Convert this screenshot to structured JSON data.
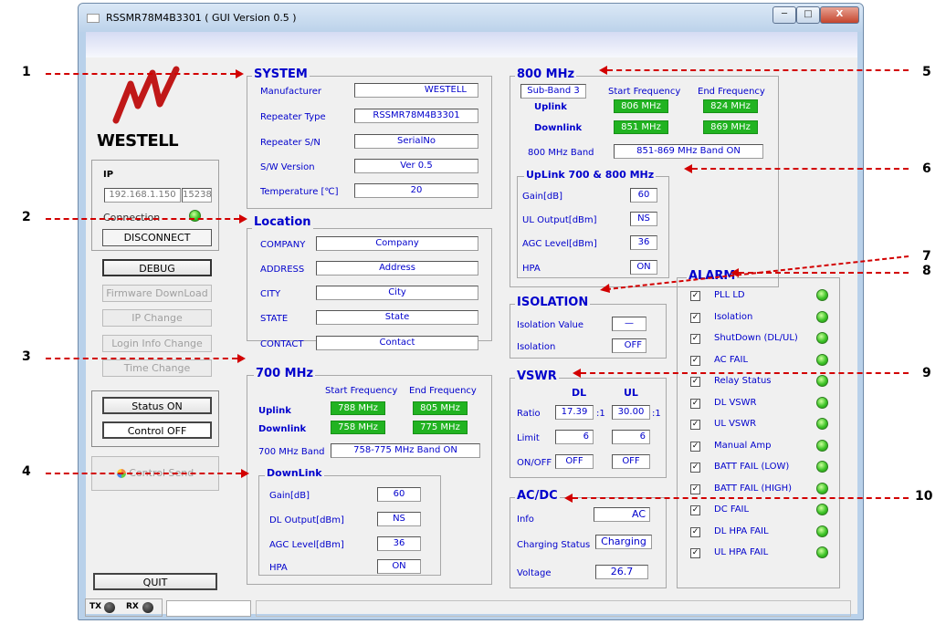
{
  "window": {
    "title": "RSSMR78M4B3301 ( GUI Version 0.5 )",
    "min": "─",
    "max": "□",
    "close": "X"
  },
  "logo": {
    "brand": "WESTELL"
  },
  "sidebar": {
    "ip_label": "IP",
    "ip_value": "192.168.1.150",
    "port_value": "15238",
    "connection_label": "Connection",
    "disconnect": "DISCONNECT",
    "debug": "DEBUG",
    "firmware": "Firmware DownLoad",
    "ip_change": "IP Change",
    "login_info": "Login Info Change",
    "time_change": "Time Change",
    "status_on": "Status ON",
    "control_off": "Control OFF",
    "control_send": "Control Send",
    "quit": "QUIT"
  },
  "statusbar": {
    "tx": "TX",
    "rx": "RX"
  },
  "system": {
    "title": "SYSTEM",
    "rows": [
      {
        "label": "Manufacturer",
        "value": "WESTELL"
      },
      {
        "label": "Repeater Type",
        "value": "RSSMR78M4B3301"
      },
      {
        "label": "Repeater S/N",
        "value": "SerialNo"
      },
      {
        "label": "S/W Version",
        "value": "Ver 0.5"
      },
      {
        "label": "Temperature [℃]",
        "value": "20"
      }
    ]
  },
  "location": {
    "title": "Location",
    "rows": [
      {
        "label": "COMPANY",
        "value": "Company"
      },
      {
        "label": "ADDRESS",
        "value": "Address"
      },
      {
        "label": "CITY",
        "value": "City"
      },
      {
        "label": "STATE",
        "value": "State"
      },
      {
        "label": "CONTACT",
        "value": "Contact"
      }
    ]
  },
  "mhz700": {
    "title": "700 MHz",
    "start_hdr": "Start Frequency",
    "end_hdr": "End Frequency",
    "uplink": "Uplink",
    "up_start": "788 MHz",
    "up_end": "805 MHz",
    "downlink": "Downlink",
    "down_start": "758 MHz",
    "down_end": "775 MHz",
    "band_label": "700 MHz Band",
    "band_value": "758-775 MHz Band ON"
  },
  "downlink": {
    "title": "DownLink",
    "rows": [
      {
        "label": "Gain[dB]",
        "value": "60"
      },
      {
        "label": "DL Output[dBm]",
        "value": "NS"
      },
      {
        "label": "AGC Level[dBm]",
        "value": "36"
      },
      {
        "label": "HPA",
        "value": "ON"
      }
    ]
  },
  "mhz800": {
    "title": "800 MHz",
    "subband": "Sub-Band 3",
    "start_hdr": "Start Frequency",
    "end_hdr": "End Frequency",
    "uplink": "Uplink",
    "up_start": "806 MHz",
    "up_end": "824 MHz",
    "downlink": "Downlink",
    "down_start": "851 MHz",
    "down_end": "869 MHz",
    "band_label": "800 MHz Band",
    "band_value": "851-869 MHz Band ON"
  },
  "uplink78": {
    "title": "UpLink 700 & 800 MHz",
    "rows": [
      {
        "label": "Gain[dB]",
        "value": "60"
      },
      {
        "label": "UL Output[dBm]",
        "value": "NS"
      },
      {
        "label": "AGC Level[dBm]",
        "value": "36"
      },
      {
        "label": "HPA",
        "value": "ON"
      }
    ]
  },
  "isolation": {
    "title": "ISOLATION",
    "value_label": "Isolation Value",
    "value": "—",
    "iso_label": "Isolation",
    "iso_value": "OFF"
  },
  "vswr": {
    "title": "VSWR",
    "dl": "DL",
    "ul": "UL",
    "ratio_label": "Ratio",
    "ratio_dl": "17.39",
    "ratio_ul": "30.00",
    "ratio_suffix": ":1",
    "limit_label": "Limit",
    "limit_dl": "6",
    "limit_ul": "6",
    "onoff_label": "ON/OFF",
    "onoff_dl": "OFF",
    "onoff_ul": "OFF"
  },
  "acdc": {
    "title": "AC/DC",
    "info_label": "Info",
    "info": "AC",
    "charging_label": "Charging Status",
    "charging": "Charging",
    "voltage_label": "Voltage",
    "voltage": "26.7"
  },
  "alarm": {
    "title": "ALARM",
    "check": "✓",
    "items": [
      "PLL LD",
      "Isolation",
      "ShutDown (DL/UL)",
      "AC FAIL",
      "Relay Status",
      "DL VSWR",
      "UL VSWR",
      "Manual Amp",
      "BATT FAIL (LOW)",
      "BATT FAIL (HIGH)",
      "DC FAIL",
      "DL HPA FAIL",
      "UL HPA FAIL"
    ]
  },
  "callouts": [
    "1",
    "2",
    "3",
    "4",
    "5",
    "6",
    "7",
    "8",
    "9",
    "10"
  ],
  "colors": {
    "label_blue": "#0000cc",
    "led_green": "#3ec428",
    "freq_green": "#21b321",
    "callout_red": "#d20000"
  }
}
